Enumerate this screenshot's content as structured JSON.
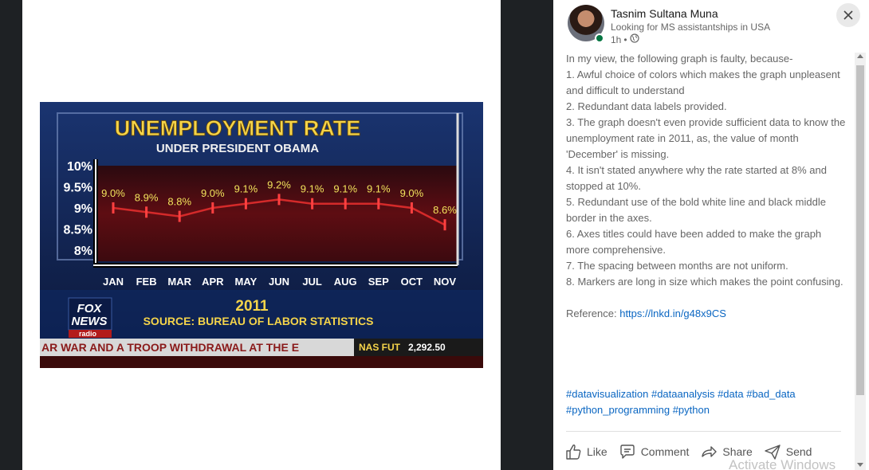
{
  "image": {
    "title": "UNEMPLOYMENT RATE",
    "subtitle": "UNDER PRESIDENT OBAMA",
    "year": "2011",
    "source": "SOURCE: BUREAU OF LABOR STATISTICS",
    "logo_line1": "FOX",
    "logo_line2": "NEWS",
    "logo_line3": "radio",
    "ticker": "AR WAR AND A TROOP WITHDRAWAL AT THE E",
    "market_label": "NAS FUT",
    "market_value": "2,292.50",
    "colors": {
      "title": "#f5d44a",
      "background": "#0c1a3e",
      "plot": "#5e0d12",
      "line": "#d42a2a",
      "label": "#f2e35c"
    }
  },
  "chart_data": {
    "type": "line",
    "title": "UNEMPLOYMENT RATE",
    "subtitle": "UNDER PRESIDENT OBAMA",
    "categories": [
      "JAN",
      "FEB",
      "MAR",
      "APR",
      "MAY",
      "JUN",
      "JUL",
      "AUG",
      "SEP",
      "OCT",
      "NOV"
    ],
    "values": [
      9.0,
      8.9,
      8.8,
      9.0,
      9.1,
      9.2,
      9.1,
      9.1,
      9.1,
      9.0,
      8.6
    ],
    "data_labels": [
      "9.0%",
      "8.9%",
      "8.8%",
      "9.0%",
      "9.1%",
      "9.2%",
      "9.1%",
      "9.1%",
      "9.1%",
      "9.0%",
      "8.6%"
    ],
    "y_ticks": [
      "10%",
      "9.5%",
      "9%",
      "8.5%",
      "8%"
    ],
    "ylim": [
      8,
      10
    ],
    "xlabel": "",
    "ylabel": "",
    "grid": false,
    "legend": "none"
  },
  "post": {
    "author": "Tasnim Sultana Muna",
    "headline": "Looking for MS assistantships in USA",
    "time": "1h",
    "visibility_icon": "globe-icon",
    "body": [
      "In my view, the following graph is faulty, because-",
      "1. Awful choice of colors which makes the graph unpleasent and difficult to understand",
      "2. Redundant data labels provided.",
      "3. The graph doesn't even provide sufficient data to know the unemployment rate in 2011, as, the value of month 'December' is missing.",
      "4. It isn't stated anywhere why the rate started at 8% and stopped at 10%.",
      "5. Redundant use of the bold white line and black middle border in the axes.",
      "6. Axes titles could have been added to make the graph more comprehensive.",
      "7. The spacing between months are not uniform.",
      "8. Markers are long in size which makes the point confusing."
    ],
    "reference_label": "Reference:",
    "reference_link": "https://lnkd.in/g48x9CS",
    "hashtags_line1": "#datavisualization #dataanalysis #data #bad_data",
    "hashtags_line2": "#python_programming #python"
  },
  "actions": {
    "like": "Like",
    "comment": "Comment",
    "share": "Share",
    "send": "Send"
  },
  "watermark": "Activate Windows"
}
